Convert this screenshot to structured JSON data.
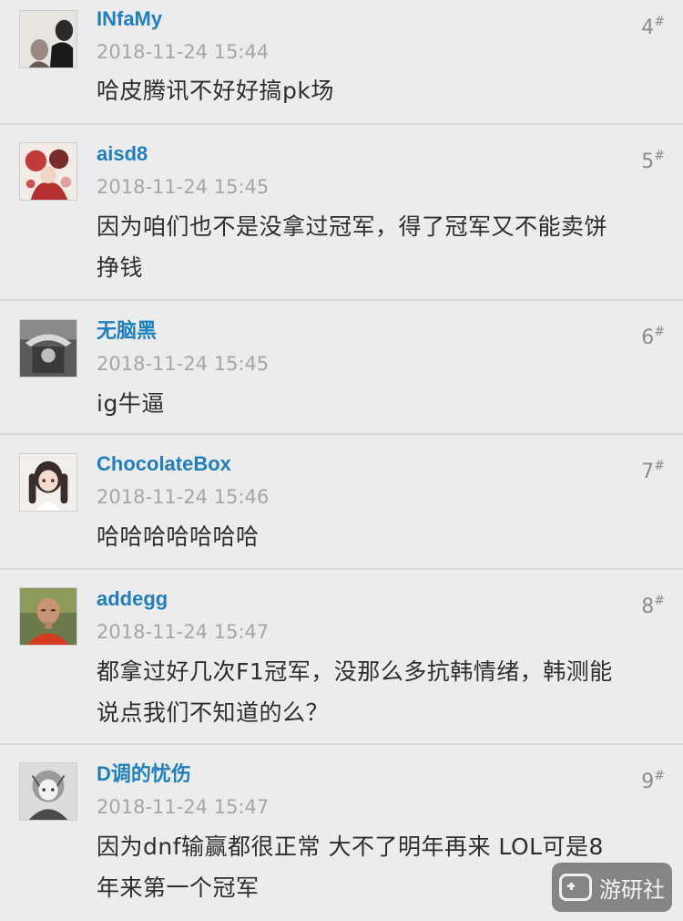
{
  "comments": [
    {
      "username": "INfaMy",
      "time": "2018-11-24 15:44",
      "text": "哈皮腾讯不好好搞pk场",
      "floor": "4"
    },
    {
      "username": "aisd8",
      "time": "2018-11-24 15:45",
      "text_lines": [
        "因为咱们也不是没拿过冠军，得了冠军又不能卖饼",
        "挣钱"
      ],
      "floor": "5"
    },
    {
      "username": "无脑黑",
      "time": "2018-11-24 15:45",
      "text": "ig牛逼",
      "floor": "6"
    },
    {
      "username": "ChocolateBox",
      "time": "2018-11-24 15:46",
      "text": "哈哈哈哈哈哈哈",
      "floor": "7"
    },
    {
      "username": "addegg",
      "time": "2018-11-24 15:47",
      "text_lines": [
        "都拿过好几次F1冠军，没那么多抗韩情绪，韩测能",
        "说点我们不知道的么？"
      ],
      "floor": "8"
    },
    {
      "username": "D调的忧伤",
      "time": "2018-11-24 15:47",
      "text_lines": [
        "因为dnf输赢都很正常 大不了明年再来 LOL可是8",
        "年来第一个冠军"
      ],
      "floor": "9"
    }
  ],
  "floor_suffix": "#",
  "watermark": {
    "text": "游研社",
    "icon": "gamepad-icon"
  }
}
